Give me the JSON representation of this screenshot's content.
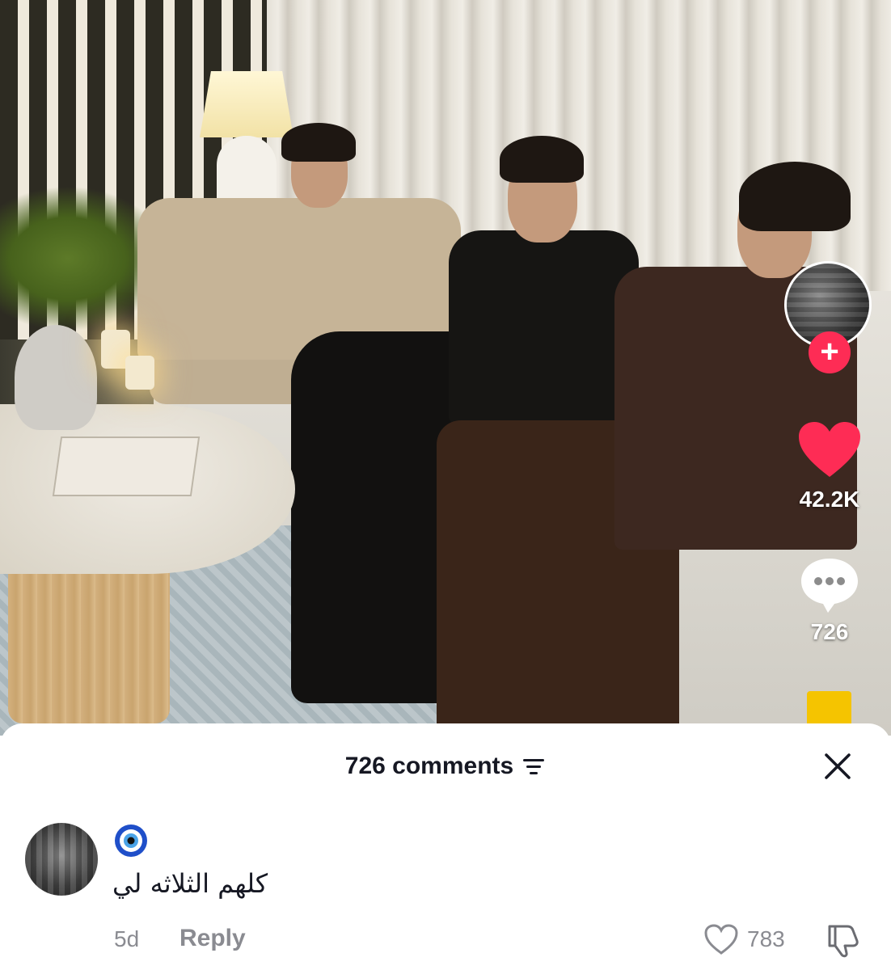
{
  "video": {
    "like_count": "42.2K",
    "comment_count": "726",
    "follow_symbol": "+"
  },
  "comments_sheet": {
    "title": "726 comments",
    "comment": {
      "username_emoji": "🧿",
      "text": "كلهم الثلاثه لي",
      "age": "5d",
      "reply_label": "Reply",
      "like_count": "783"
    }
  },
  "colors": {
    "like_red": "#fe2c55",
    "save_yellow": "#f5c400",
    "muted_text": "#8a8b91"
  },
  "icons": [
    "heart-icon",
    "comment-bubble-icon",
    "sort-icon",
    "close-icon",
    "heart-outline-icon",
    "dislike-icon",
    "nazar-amulet-icon"
  ]
}
